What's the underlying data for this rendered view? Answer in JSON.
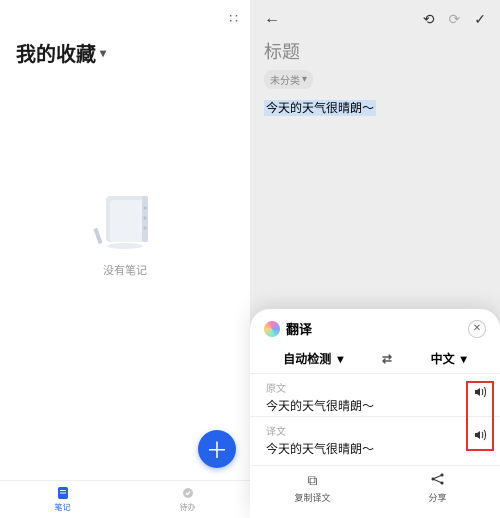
{
  "left": {
    "title": "我的收藏",
    "empty_text": "没有笔记",
    "nav": {
      "notes": "笔记",
      "todo": "待办"
    }
  },
  "right": {
    "title_placeholder": "标题",
    "tag": "未分类",
    "content": "今天的天气很晴朗～"
  },
  "panel": {
    "title": "翻译",
    "lang_from": "自动检测",
    "lang_to": "中文",
    "src_label": "原文",
    "src_text": "今天的天气很晴朗～",
    "dst_label": "译文",
    "dst_text": "今天的天气很晴朗～",
    "copy": "复制译文",
    "share": "分享"
  }
}
